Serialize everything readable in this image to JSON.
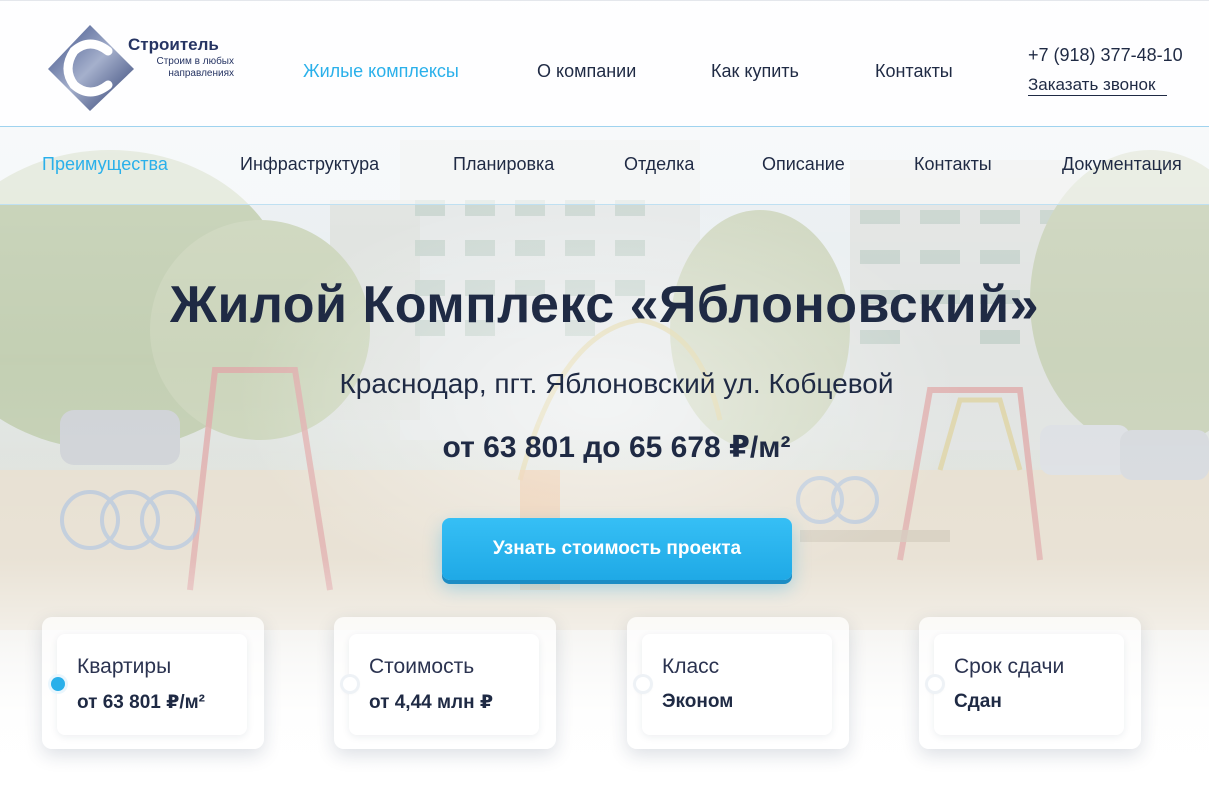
{
  "brand": {
    "title": "Строитель",
    "tagline": "Строим в любых направлениях"
  },
  "main_nav": [
    {
      "label": "Жилые комплексы",
      "active": true
    },
    {
      "label": "О компании",
      "active": false
    },
    {
      "label": "Как купить",
      "active": false
    },
    {
      "label": "Контакты",
      "active": false
    }
  ],
  "contact": {
    "phone": "+7 (918) 377-48-10",
    "callback_label": "Заказать звонок"
  },
  "sub_nav": [
    {
      "label": "Преимущества",
      "active": true
    },
    {
      "label": "Инфраструктура",
      "active": false
    },
    {
      "label": "Планировка",
      "active": false
    },
    {
      "label": "Отделка",
      "active": false
    },
    {
      "label": "Описание",
      "active": false
    },
    {
      "label": "Контакты",
      "active": false
    },
    {
      "label": "Документация",
      "active": false
    }
  ],
  "hero": {
    "title_prefix": "Жилой Комплекс «",
    "title_name": "Яблоновский",
    "title_suffix": "»",
    "address": "Краснодар, пгт. Яблоновский ул. Кобцевой",
    "price": "от 63 801 до 65 678 ₽/м²",
    "cta_label": "Узнать стоимость проекта"
  },
  "cards": [
    {
      "label": "Квартиры",
      "value": "от 63 801 ₽/м²",
      "active": true
    },
    {
      "label": "Стоимость",
      "value": "от 4,44 млн ₽",
      "active": false
    },
    {
      "label": "Класс",
      "value": "Эконом",
      "active": false
    },
    {
      "label": "Срок сдачи",
      "value": "Сдан",
      "active": false
    }
  ],
  "colors": {
    "accent": "#2ab0ea",
    "text": "#1f2a44",
    "brand_navy": "#263463"
  }
}
